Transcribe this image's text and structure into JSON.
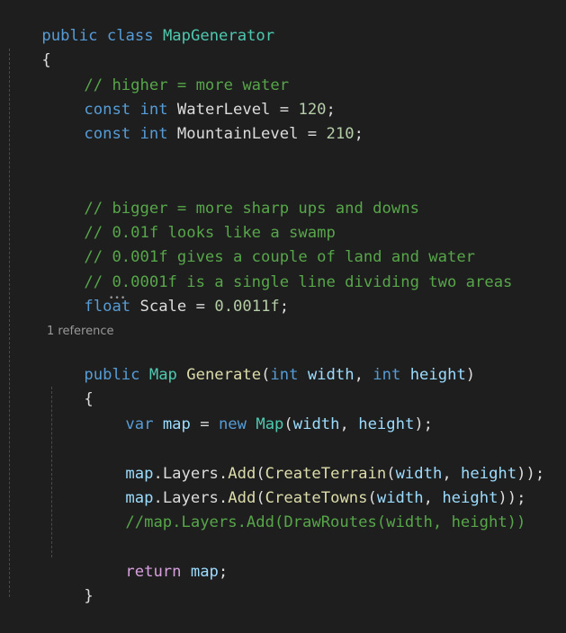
{
  "editor": {
    "class_decl": {
      "kw": "public class",
      "name": "MapGenerator"
    },
    "open_brace": "{",
    "close_brace_inner": "}",
    "comment_water": "// higher = more water",
    "water_const": {
      "kw": "const int",
      "name": "WaterLevel",
      "op": "=",
      "value": "120",
      "end": ";"
    },
    "mountain_const": {
      "kw": "const int",
      "name": "MountainLevel",
      "op": "=",
      "value": "210",
      "end": ";"
    },
    "comments_scale": [
      "// bigger = more sharp ups and downs",
      "// 0.01f looks like a swamp",
      "// 0.001f gives a couple of land and water",
      "// 0.0001f is a single line dividing two areas"
    ],
    "scale_decl": {
      "kw": "float",
      "name": "Scale",
      "op": "=",
      "value": "0.0011f",
      "end": ";"
    },
    "codelens": "1 reference",
    "method_decl": {
      "kw": "public",
      "return_type": "Map",
      "name": "Generate",
      "open": "(",
      "p1_type": "int",
      "p1_name": "width",
      "sep": ",",
      "p2_type": "int",
      "p2_name": "height",
      "close": ")"
    },
    "var_line": {
      "kw": "var",
      "name": "map",
      "op": "=",
      "new": "new",
      "type": "Map",
      "open": "(",
      "a1": "width",
      "sep": ",",
      "a2": "height",
      "close": ");"
    },
    "add_terrain": {
      "obj": "map",
      "dot1": ".",
      "prop": "Layers",
      "dot2": ".",
      "method": "Add",
      "open": "(",
      "call": "CreateTerrain",
      "open2": "(",
      "a1": "width",
      "sep": ",",
      "a2": "height",
      "close": "));"
    },
    "add_towns": {
      "obj": "map",
      "dot1": ".",
      "prop": "Layers",
      "dot2": ".",
      "method": "Add",
      "open": "(",
      "call": "CreateTowns",
      "open2": "(",
      "a1": "width",
      "sep": ",",
      "a2": "height",
      "close": "));"
    },
    "commented_routes": "//map.Layers.Add(DrawRoutes(width, height))",
    "return_line": {
      "kw": "return",
      "value": "map",
      "end": ";"
    }
  },
  "colors": {
    "background": "#1e1e1e",
    "keyword": "#569cd6",
    "type": "#4ec9b0",
    "method": "#dcdcaa",
    "parameter": "#9cdcfe",
    "number": "#b5cea8",
    "comment": "#57a64a",
    "control": "#d8a0df"
  }
}
